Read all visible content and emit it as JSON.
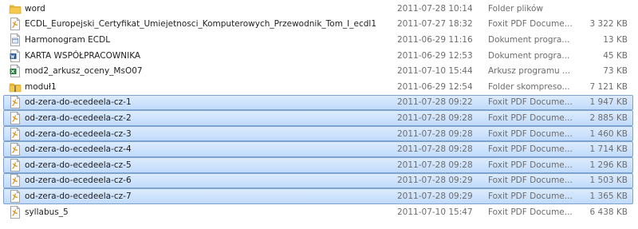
{
  "files": [
    {
      "icon": "folder-icon",
      "name": "word",
      "date": "2011-07-28 10:14",
      "type": "Folder plików",
      "size": "",
      "selected": false
    },
    {
      "icon": "pdf-icon",
      "name": "ECDL_Europejski_Certyfikat_Umiejetnosci_Komputerowych_Przewodnik_Tom_I_ecdl1",
      "date": "2011-07-27 18:32",
      "type": "Foxit PDF Docume...",
      "size": "3 322 KB",
      "selected": false
    },
    {
      "icon": "program-icon",
      "name": "Harmonogram ECDL",
      "date": "2011-06-29 11:16",
      "type": "Dokument progra...",
      "size": "13 KB",
      "selected": false
    },
    {
      "icon": "word-document-icon",
      "name": "KARTA WSPÓŁPRACOWNIKA",
      "date": "2011-06-29 12:53",
      "type": "Dokument progra...",
      "size": "45 KB",
      "selected": false
    },
    {
      "icon": "spreadsheet-icon",
      "name": "mod2_arkusz_oceny_MsO07",
      "date": "2011-07-10 15:44",
      "type": "Arkusz programu ...",
      "size": "73 KB",
      "selected": false
    },
    {
      "icon": "zip-folder-icon",
      "name": "moduł1",
      "date": "2011-06-29 12:54",
      "type": "Folder skompreso...",
      "size": "7 121 KB",
      "selected": false
    },
    {
      "icon": "pdf-icon",
      "name": "od-zera-do-ecedeela-cz-1",
      "date": "2011-07-28 09:22",
      "type": "Foxit PDF Docume...",
      "size": "1 947 KB",
      "selected": true
    },
    {
      "icon": "pdf-icon",
      "name": "od-zera-do-ecedeela-cz-2",
      "date": "2011-07-28 09:28",
      "type": "Foxit PDF Docume...",
      "size": "2 885 KB",
      "selected": true
    },
    {
      "icon": "pdf-icon",
      "name": "od-zera-do-ecedeela-cz-3",
      "date": "2011-07-28 09:28",
      "type": "Foxit PDF Docume...",
      "size": "1 460 KB",
      "selected": true
    },
    {
      "icon": "pdf-icon",
      "name": "od-zera-do-ecedeela-cz-4",
      "date": "2011-07-28 09:28",
      "type": "Foxit PDF Docume...",
      "size": "1 714 KB",
      "selected": true
    },
    {
      "icon": "pdf-icon",
      "name": "od-zera-do-ecedeela-cz-5",
      "date": "2011-07-28 09:28",
      "type": "Foxit PDF Docume...",
      "size": "1 296 KB",
      "selected": true
    },
    {
      "icon": "pdf-icon",
      "name": "od-zera-do-ecedeela-cz-6",
      "date": "2011-07-28 09:29",
      "type": "Foxit PDF Docume...",
      "size": "1 503 KB",
      "selected": true
    },
    {
      "icon": "pdf-icon",
      "name": "od-zera-do-ecedeela-cz-7",
      "date": "2011-07-28 09:29",
      "type": "Foxit PDF Docume...",
      "size": "1 365 KB",
      "selected": true
    },
    {
      "icon": "pdf-icon",
      "name": "syllabus_5",
      "date": "2011-07-10 15:47",
      "type": "Foxit PDF Docume...",
      "size": "6 438 KB",
      "selected": false
    }
  ],
  "colors": {
    "selection_fill": "#cce0fb",
    "selection_border": "#7da2ce",
    "folder": "#f3c84b",
    "pdf_accent": "#d9901a",
    "word_blue": "#2b5797",
    "excel_green": "#1f7a3b"
  }
}
